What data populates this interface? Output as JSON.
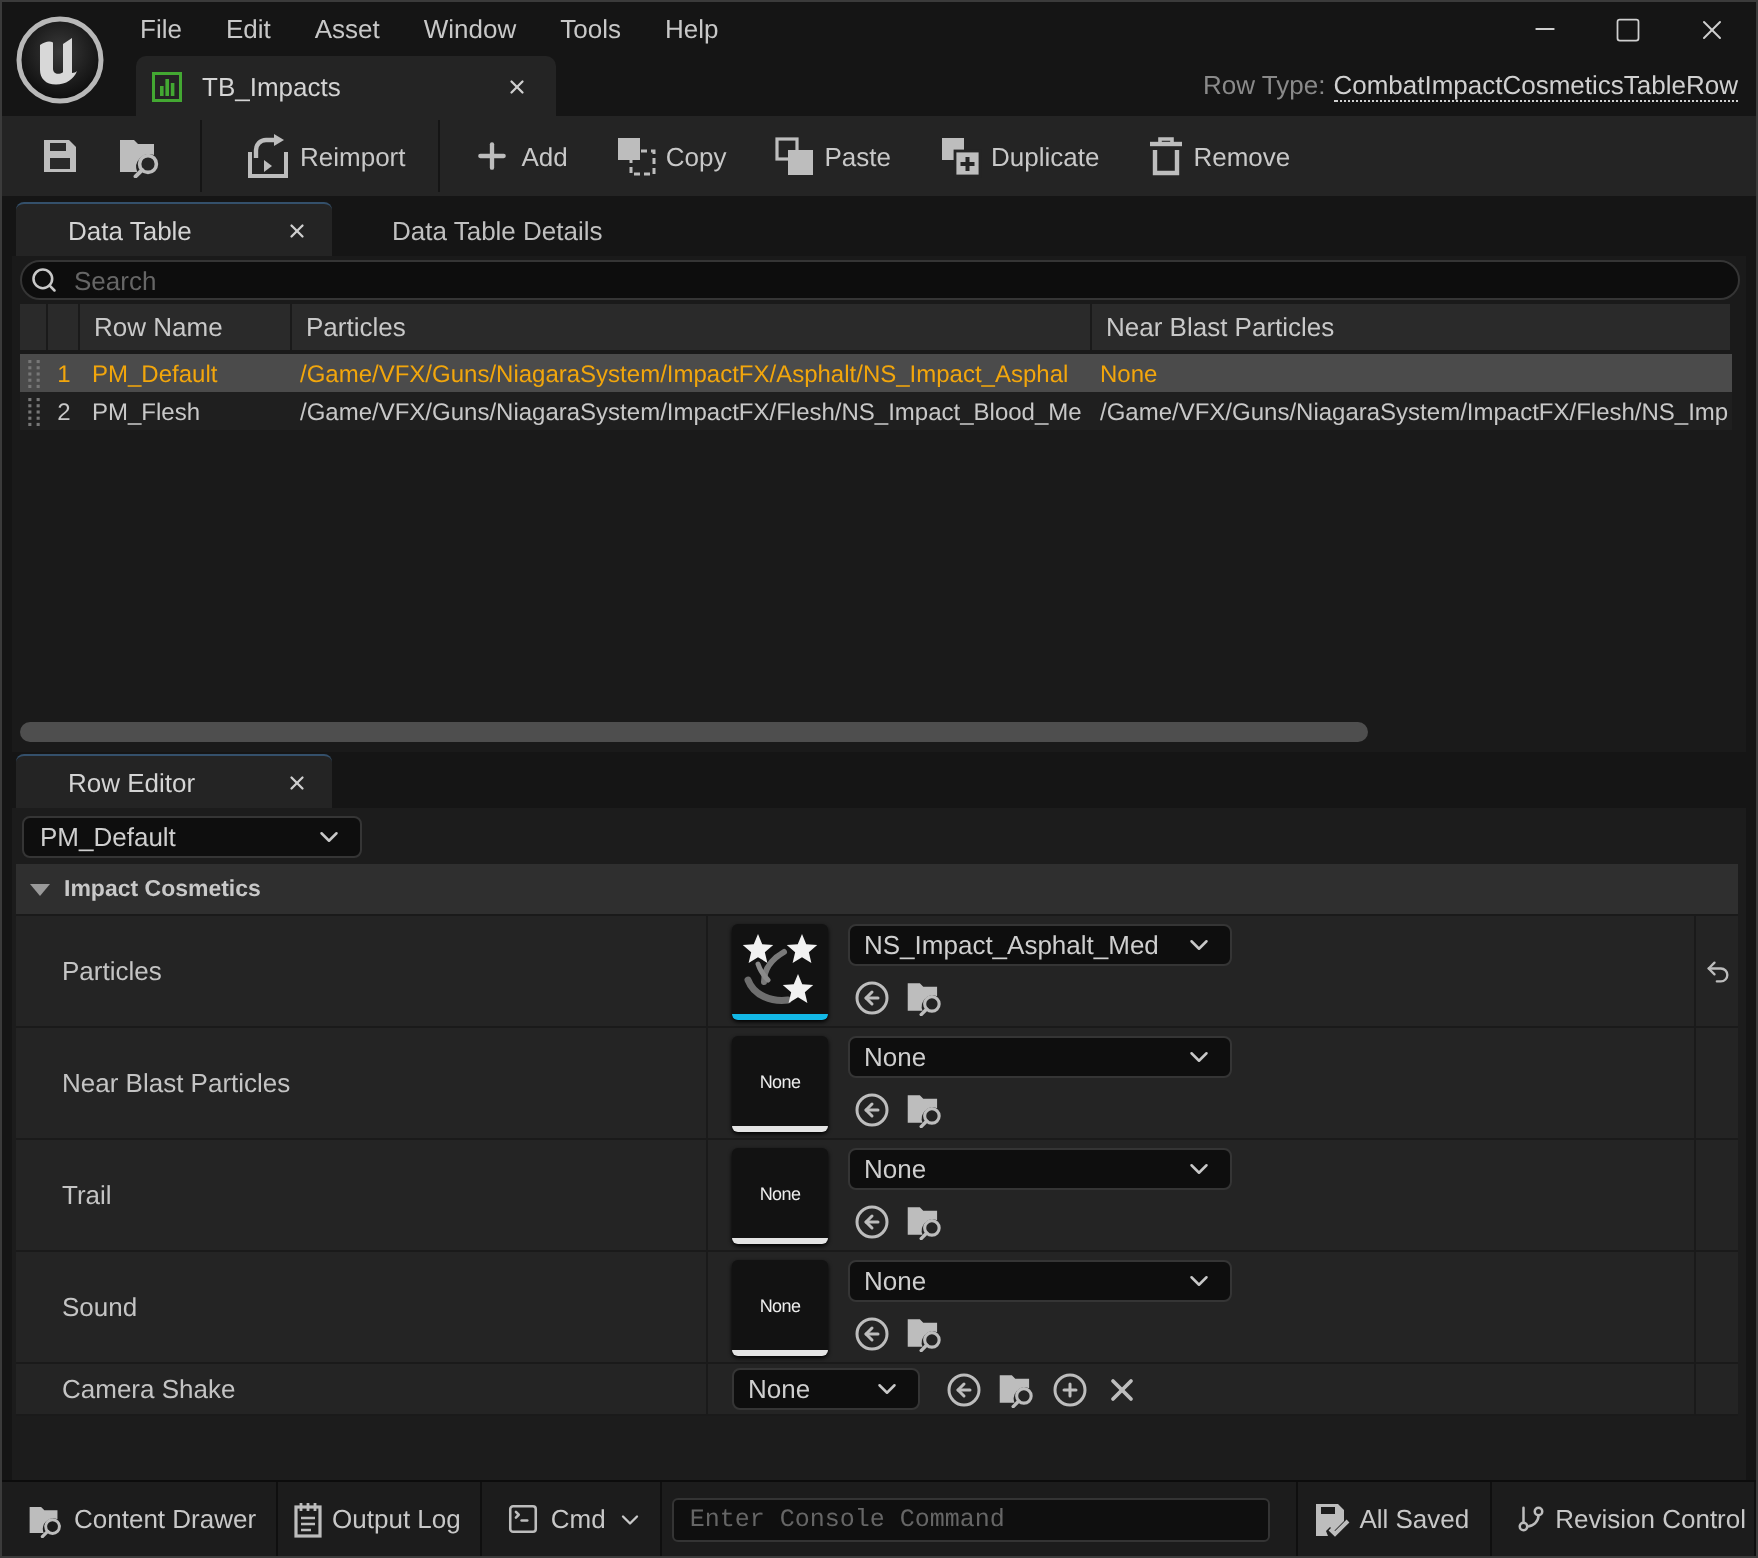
{
  "menu": [
    {
      "label": "File"
    },
    {
      "label": "Edit"
    },
    {
      "label": "Asset"
    },
    {
      "label": "Window"
    },
    {
      "label": "Tools"
    },
    {
      "label": "Help"
    }
  ],
  "asset_tab": {
    "label": "TB_Impacts"
  },
  "row_type": {
    "label": "Row Type:",
    "value": "CombatImpactCosmeticsTableRow"
  },
  "toolbar": [
    {
      "label": "Reimport"
    },
    {
      "label": "Add"
    },
    {
      "label": "Copy"
    },
    {
      "label": "Paste"
    },
    {
      "label": "Duplicate"
    },
    {
      "label": "Remove"
    }
  ],
  "panel_tabs": [
    {
      "label": "Data Table",
      "selected": true
    },
    {
      "label": "Data Table Details",
      "selected": false
    }
  ],
  "search": {
    "placeholder": "Search"
  },
  "table": {
    "columns": [
      "Row Name",
      "Particles",
      "Near Blast Particles"
    ],
    "rows": [
      {
        "index": "1",
        "selected": true,
        "cells": [
          "PM_Default",
          "/Game/VFX/Guns/NiagaraSystem/ImpactFX/Asphalt/NS_Impact_Asphal",
          "None"
        ]
      },
      {
        "index": "2",
        "selected": false,
        "cells": [
          "PM_Flesh",
          "/Game/VFX/Guns/NiagaraSystem/ImpactFX/Flesh/NS_Impact_Blood_Me",
          "/Game/VFX/Guns/NiagaraSystem/ImpactFX/Flesh/NS_Imp"
        ]
      }
    ]
  },
  "row_editor": {
    "tab": {
      "label": "Row Editor",
      "selected": true
    },
    "row_select": {
      "value": "PM_Default"
    },
    "category": {
      "label": "Impact Cosmetics",
      "expanded": true
    },
    "properties": [
      {
        "kind": "asset",
        "name": "Particles",
        "assigned": true,
        "value": "NS_Impact_Asphalt_Med",
        "modified": true
      },
      {
        "kind": "asset",
        "name": "Near Blast Particles",
        "assigned": false,
        "thumbnail_text": "None",
        "value": "None",
        "modified": false
      },
      {
        "kind": "asset",
        "name": "Trail",
        "assigned": false,
        "thumbnail_text": "None",
        "value": "None",
        "modified": false
      },
      {
        "kind": "asset",
        "name": "Sound",
        "assigned": false,
        "thumbnail_text": "None",
        "value": "None",
        "modified": false
      },
      {
        "kind": "class",
        "name": "Camera Shake",
        "value": "None",
        "modified": false
      }
    ]
  },
  "status_bar": {
    "buttons": [
      {
        "label": "Content Drawer"
      },
      {
        "label": "Output Log"
      }
    ],
    "cmd": {
      "label": "Cmd"
    },
    "console": {
      "placeholder": "Enter Console Command"
    },
    "indicators": [
      {
        "label": "All Saved"
      },
      {
        "label": "Revision Control"
      }
    ]
  }
}
